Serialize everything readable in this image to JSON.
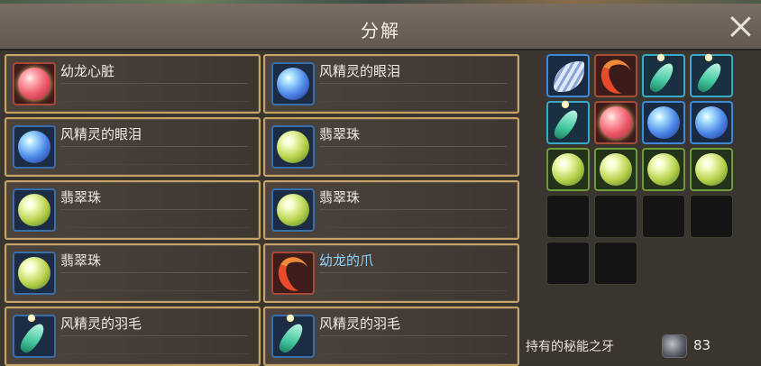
{
  "window": {
    "title": "分解"
  },
  "items": [
    {
      "name": "幼龙心脏",
      "icon": "pink-orb"
    },
    {
      "name": "风精灵的眼泪",
      "icon": "blue-orb"
    },
    {
      "name": "风精灵的眼泪",
      "icon": "blue-orb"
    },
    {
      "name": "翡翠珠",
      "icon": "green-orb"
    },
    {
      "name": "翡翠珠",
      "icon": "green-orb"
    },
    {
      "name": "翡翠珠",
      "icon": "green-orb"
    },
    {
      "name": "翡翠珠",
      "icon": "green-orb"
    },
    {
      "name": "幼龙的爪",
      "icon": "dragon-claw",
      "highlight": true
    },
    {
      "name": "风精灵的羽毛",
      "icon": "teal-feather"
    },
    {
      "name": "风精灵的羽毛",
      "icon": "teal-feather"
    }
  ],
  "grid": [
    "wing",
    "dragon-claw",
    "teal-feather",
    "teal-feather",
    "teal-feather",
    "pink-orb",
    "blue-orb",
    "blue-orb",
    "green-orb",
    "green-orb",
    "green-orb",
    "green-orb",
    "empty",
    "empty",
    "empty",
    "empty",
    "empty",
    "empty"
  ],
  "footer": {
    "label": "持有的秘能之牙",
    "count": "83"
  },
  "colors": {
    "card_border": "#c7a466",
    "highlight_text": "#8fd2ff",
    "background": "#3b352f"
  }
}
